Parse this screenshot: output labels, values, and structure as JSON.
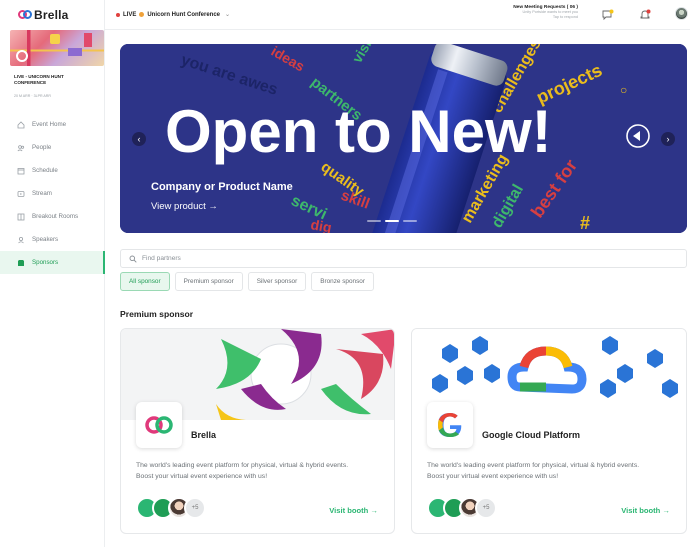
{
  "app": {
    "logo": "Brella"
  },
  "event": {
    "title": "LIVE - UNICORN HUNT CONFERENCE",
    "date": "20 M ARR · 3LPR ARR"
  },
  "sidebar": {
    "items": [
      {
        "label": "Event Home",
        "icon": "home-icon",
        "active": false
      },
      {
        "label": "People",
        "icon": "people-icon",
        "active": false
      },
      {
        "label": "Schedule",
        "icon": "calendar-icon",
        "active": false
      },
      {
        "label": "Stream",
        "icon": "stream-icon",
        "active": false
      },
      {
        "label": "Breakout Rooms",
        "icon": "rooms-icon",
        "active": false
      },
      {
        "label": "Speakers",
        "icon": "speakers-icon",
        "active": false
      },
      {
        "label": "Sponsors",
        "icon": "sponsors-icon",
        "active": true
      }
    ]
  },
  "header": {
    "live_label": "LIVE",
    "event_name": "Unicorn Hunt Conference",
    "meeting_title": "New Meeting Requests ( 06 )",
    "meeting_sub1": "Unity Portside wants to meet you",
    "meeting_sub2": "Tap to respond"
  },
  "hero": {
    "headline": "Open to New!",
    "company": "Company or Product Name",
    "cta": "View product →",
    "colors": {
      "bg": "#2d3488",
      "yellow": "#f5c518",
      "green": "#3fbf6b",
      "red": "#e0403e"
    }
  },
  "search": {
    "placeholder": "Find partners"
  },
  "filters": [
    {
      "label": "All sponsor",
      "active": true
    },
    {
      "label": "Premium sponsor",
      "active": false
    },
    {
      "label": "Silver sponsor",
      "active": false
    },
    {
      "label": "Bronze sponsor",
      "active": false
    }
  ],
  "section": {
    "title": "Premium sponsor"
  },
  "cards": [
    {
      "name": "Brella",
      "description": "The world's leading event platform for physical, virtual & hybrid events. Boost your virtual event experience with us!",
      "more": "+5",
      "visit": "Visit booth →"
    },
    {
      "name": "Google Cloud Platform",
      "description": "The world's leading event platform for physical, virtual & hybrid events. Boost your virtual event experience with us!",
      "more": "+5",
      "visit": "Visit booth →"
    }
  ],
  "colors": {
    "accent": "#2bb673",
    "active_bg": "#e9f7ef"
  }
}
